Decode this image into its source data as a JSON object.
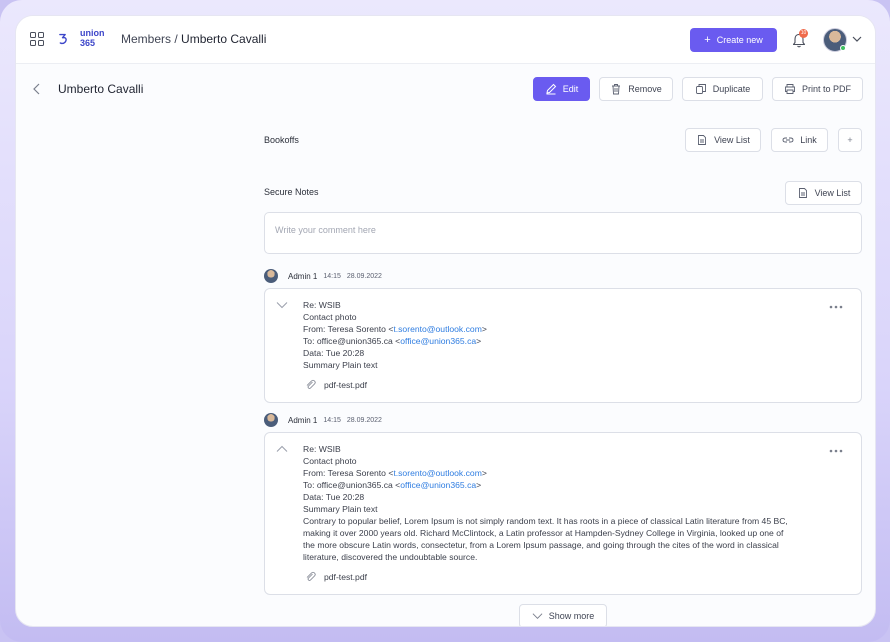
{
  "header": {
    "logo_text_line1": "union",
    "logo_text_line2": "365",
    "breadcrumb_parent": "Members",
    "breadcrumb_separator": " / ",
    "breadcrumb_current": "Umberto Cavalli",
    "create_new_label": "Create new",
    "notification_count": "10"
  },
  "page": {
    "title": "Umberto Cavalli",
    "actions": {
      "edit": "Edit",
      "remove": "Remove",
      "duplicate": "Duplicate",
      "print": "Print to PDF"
    }
  },
  "bookoffs": {
    "label": "Bookoffs",
    "view_list": "View List",
    "link": "Link",
    "add": "+"
  },
  "secure_notes": {
    "label": "Secure Notes",
    "view_list": "View List",
    "comment_placeholder": "Write your comment here"
  },
  "notes": [
    {
      "author": "Admin 1",
      "time": "14:15",
      "date": "28.09.2022",
      "subject": "Re: WSIB",
      "line2": "Contact photo",
      "from_prefix": "From: Teresa Sorento <",
      "from_email": "t.sorento@outlook.com",
      "from_suffix": ">",
      "to_prefix": "To: office@union365.ca <",
      "to_email": "office@union365.ca",
      "to_suffix": ">",
      "data": "Data: Tue 20:28",
      "summary": "Summary Plain text",
      "attachment": "pdf-test.pdf"
    },
    {
      "author": "Admin 1",
      "time": "14:15",
      "date": "28.09.2022",
      "subject": "Re: WSIB",
      "line2": "Contact photo",
      "from_prefix": "From: Teresa Sorento <",
      "from_email": "t.sorento@outlook.com",
      "from_suffix": ">",
      "to_prefix": "To: office@union365.ca <",
      "to_email": "office@union365.ca",
      "to_suffix": ">",
      "data": "Data: Tue 20:28",
      "summary": "Summary Plain text",
      "body": "Contrary to popular belief, Lorem Ipsum is not simply random text. It has roots in a piece of classical Latin literature from 45 BC, making it over 2000 years old. Richard McClintock, a Latin professor at Hampden-Sydney College in Virginia, looked up one of the more obscure Latin words, consectetur, from a Lorem Ipsum passage, and going through the cites of the word in classical literature, discovered the undoubtable source.",
      "attachment": "pdf-test.pdf"
    }
  ],
  "show_more_label": "Show more",
  "colors": {
    "accent": "#6a5bf0",
    "link": "#2f7de1",
    "badge": "#ef6a4b",
    "online": "#3fc061"
  }
}
